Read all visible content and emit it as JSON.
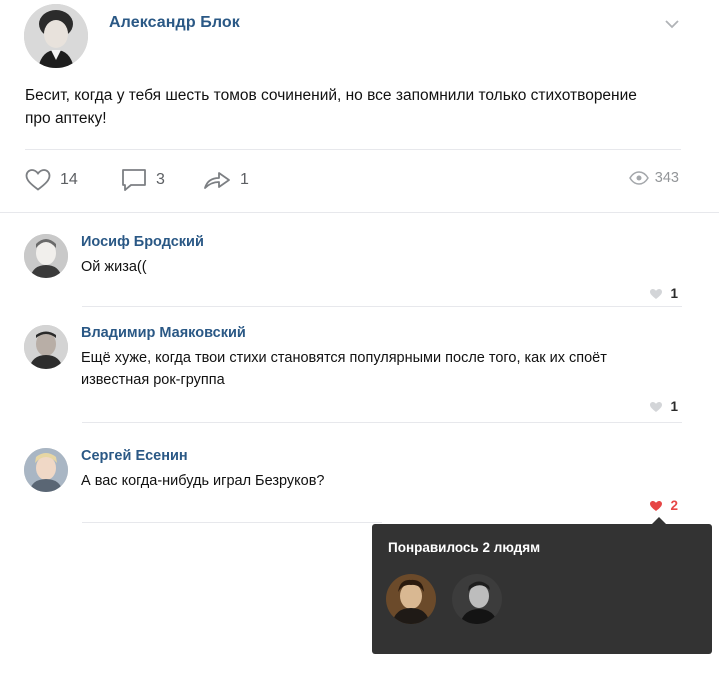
{
  "post": {
    "author": "Александр Блок",
    "text": "Бесит, когда у тебя шесть томов сочинений, но все запомнили только стихотворение про аптеку!",
    "likes": "14",
    "comments": "3",
    "shares": "1",
    "views": "343"
  },
  "comments": [
    {
      "author": "Иосиф Бродский",
      "text": "Ой жиза((",
      "likes": "1"
    },
    {
      "author": "Владимир Маяковский",
      "text": "Ещё хуже, когда твои стихи становятся популярными после того, как их споёт известная рок-группа",
      "likes": "1"
    },
    {
      "author": "Сергей Есенин",
      "text": "А вас когда-нибудь играл Безруков?",
      "likes": "2"
    }
  ],
  "likes_popup": {
    "title": "Понравилось 2 людям"
  },
  "colors": {
    "link": "#2a5885",
    "like_active": "#e64646",
    "popup_bg": "#333333"
  },
  "icons": [
    "chevron-down-icon",
    "heart-icon",
    "comment-icon",
    "share-icon",
    "eye-icon"
  ]
}
